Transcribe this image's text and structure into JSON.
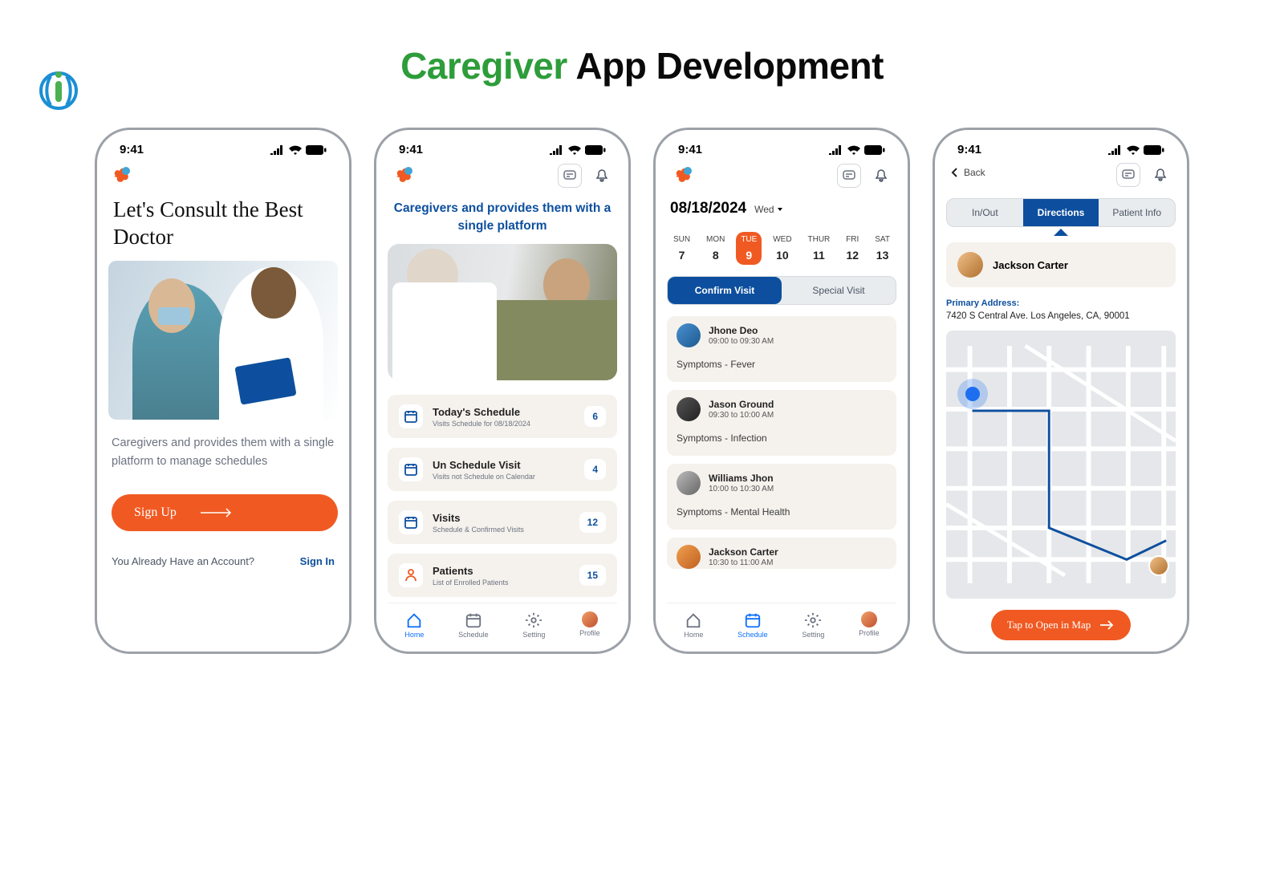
{
  "header": {
    "title_green": "Caregiver",
    "title_black": " App Development"
  },
  "status": {
    "time": "9:41"
  },
  "nav": {
    "home": "Home",
    "schedule": "Schedule",
    "setting": "Setting",
    "profile": "Profile"
  },
  "screen1": {
    "title": "Let's Consult the Best Doctor",
    "desc": "Caregivers and provides them with a single platform to manage schedules",
    "signup": "Sign Up",
    "already": "You Already Have an Account?",
    "signin": "Sign In"
  },
  "screen2": {
    "title": "Caregivers and provides them with a single platform",
    "cards": [
      {
        "title": "Today's Schedule",
        "sub": "Visits Schedule for 08/18/2024",
        "badge": "6"
      },
      {
        "title": "Un Schedule Visit",
        "sub": "Visits not Schedule on Calendar",
        "badge": "4"
      },
      {
        "title": "Visits",
        "sub": "Schedule & Confirmed Visits",
        "badge": "12"
      },
      {
        "title": "Patients",
        "sub": "List of Enrolled Patients",
        "badge": "15"
      }
    ]
  },
  "screen3": {
    "date": "08/18/2024",
    "day": "Wed",
    "week": [
      {
        "d": "SUN",
        "n": "7"
      },
      {
        "d": "MON",
        "n": "8"
      },
      {
        "d": "TUE",
        "n": "9"
      },
      {
        "d": "WED",
        "n": "10"
      },
      {
        "d": "THUR",
        "n": "11"
      },
      {
        "d": "FRI",
        "n": "12"
      },
      {
        "d": "SAT",
        "n": "13"
      }
    ],
    "tab1": "Confirm Visit",
    "tab2": "Special Visit",
    "visits": [
      {
        "name": "Jhone Deo",
        "time": "09:00 to 09:30 AM",
        "symptom": "Symptoms - Fever"
      },
      {
        "name": "Jason Ground",
        "time": "09:30 to 10:00 AM",
        "symptom": "Symptoms - Infection"
      },
      {
        "name": "Williams Jhon",
        "time": "10:00 to 10:30 AM",
        "symptom": "Symptoms - Mental Health"
      },
      {
        "name": "Jackson Carter",
        "time": "10:30 to 11:00 AM",
        "symptom": ""
      }
    ]
  },
  "screen4": {
    "back": "Back",
    "tabs": {
      "inout": "In/Out",
      "directions": "Directions",
      "info": "Patient Info"
    },
    "patient": "Jackson Carter",
    "addr_label": "Primary Address:",
    "addr": "7420 S Central Ave. Los Angeles, CA, 90001",
    "open_map": "Tap to Open in Map"
  }
}
